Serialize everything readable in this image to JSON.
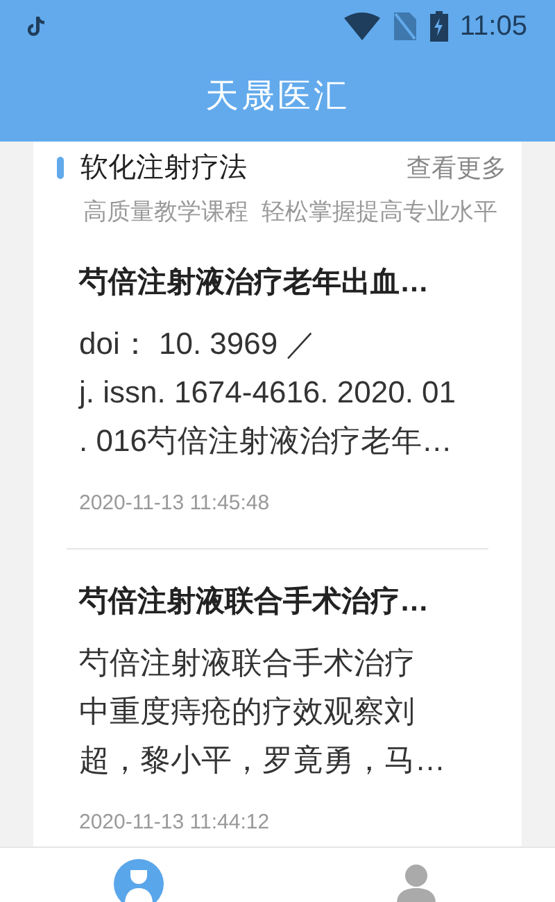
{
  "status_bar": {
    "time": "11:05"
  },
  "app_bar": {
    "title": "天晟医汇"
  },
  "section": {
    "title": "软化注射疗法",
    "more": "查看更多",
    "subtitle": "高质量教学课程  轻松掌握提高专业水平"
  },
  "articles": [
    {
      "title": "芍倍注射液治疗老年出血…",
      "body_lines": [
        "doi： 10. 3969 ／",
        "j. issn. 1674-4616. 2020. 01",
        ". 016芍倍注射液治疗老年…"
      ],
      "date": "2020-11-13 11:45:48"
    },
    {
      "title": "芍倍注射液联合手术治疗…",
      "body_lines": [
        "芍倍注射液联合手术治疗",
        "中重度痔疮的疗效观察刘",
        "超，黎小平，罗竟勇，马…"
      ],
      "date": "2020-11-13 11:44:12"
    }
  ],
  "bottom_nav": [
    {
      "kind": "doctor",
      "selected": true
    },
    {
      "kind": "person",
      "selected": false
    }
  ]
}
